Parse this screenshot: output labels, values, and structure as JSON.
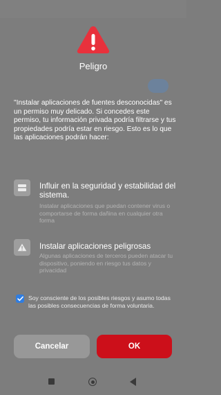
{
  "dialog": {
    "title": "Peligro",
    "intro": "\"Instalar aplicaciones de fuentes desconocidas\" es un permiso muy delicado. Si concedes este permiso, tu información privada podría filtrarse y tus propiedades podría estar en riesgo. Esto es lo que las aplicaciones podrán hacer:",
    "permissions": [
      {
        "icon": "storage-icon",
        "title": "Influir en la seguridad y estabilidad del sistema.",
        "description": "Instalar aplicaciones que puedan contener virus o comportarse de forma dañina en cualquier otra forma"
      },
      {
        "icon": "warning-triangle-icon",
        "title": "Instalar aplicaciones peligrosas",
        "description": "Algunas aplicaciones de terceros pueden atacar tu dispositivo, poniendo en riesgo tus datos y privacidad"
      }
    ],
    "acknowledge": {
      "checked": true,
      "label": "Soy consciente de los posibles riesgos y asumo todas las posibles consecuencias de forma voluntaria."
    },
    "cancel_label": "Cancelar",
    "ok_label": "OK"
  },
  "colors": {
    "danger": "#e8313c",
    "ok_button": "#cc0f1a",
    "checkbox": "#2f7de1",
    "overlay": "#7d7d7d"
  }
}
